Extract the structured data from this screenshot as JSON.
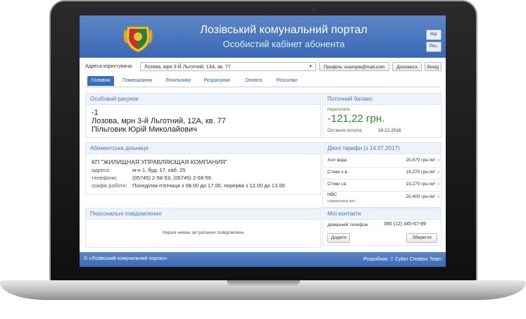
{
  "header": {
    "title": "Лозівський комунальний портал",
    "subtitle": "Особистий кабінет абонента",
    "lang_ukr": "Укр.",
    "lang_rus": "Рос."
  },
  "userbar": {
    "label": "Адреса користувача:",
    "address_value": "Лозова, мрн 3-Й Льготний, 13А, кв. 77",
    "profile_button": "Профіль: example@mail.com",
    "help_button": "Допомога",
    "exit_button": "Вихід"
  },
  "tabs": [
    "Головна",
    "Помешкання",
    "Лічильники",
    "Розрахунки",
    "Оплата",
    "Розсилки"
  ],
  "account": {
    "title": "Особовий рахунок",
    "number": "-1",
    "address": "Лозова, мрн 3-й Льготний, 12А, кв. 77",
    "owner": "Пільговик Юрій Миколайович"
  },
  "balance": {
    "title": "Поточний баланс",
    "status": "переплата",
    "amount": "-121,22 грн.",
    "last_payment_label": "Остання оплата:",
    "last_payment_date": "19.12.2016"
  },
  "subscriber": {
    "title": "Абонентська дільниця",
    "company": "КП \"ЖИЛИЩНАЯ УПРАВЛЯЮЩАЯ КОМПАНИЯ\"",
    "address_label": "адреса:",
    "address_value": "м-н 1, буд. 17, каб. 25",
    "phones_label": "телефони:",
    "phones_value": "(05745) 2-58-53; (05745) 2-58-56",
    "schedule_label": "графік роботи:",
    "schedule_value": "Понеділок-п'ятниця з 08.00 до 17.00, перерва з 12.00 до 13.00"
  },
  "tariffs": {
    "title": "Діючі тарифи (з 14.07.2017)",
    "rows": [
      {
        "name": "Хол вода",
        "value": "20,670 грн./м³"
      },
      {
        "name": "Стоки х.в.",
        "value": "19,270 грн./м³"
      },
      {
        "name": "Стоки г.в.",
        "value": "19,270 грн./м³"
      },
      {
        "name": "НВС",
        "note": "нормативне вод...",
        "value": "20,400 грн./м³"
      }
    ]
  },
  "messages": {
    "title": "Персональні повідомлення",
    "empty": "Наразі немає актуальних повідомлень"
  },
  "contacts": {
    "title": "Мої контакти",
    "phone_label": "домашній телефон",
    "phone_value": "380 (12) 345-67-89",
    "add_button": "Додати",
    "save_button": "Зберегти"
  },
  "footer": {
    "copyright": "© «Лозівський комунальний портал»",
    "dev_label": "Розробник:",
    "dev_name": "Cyber Creation Team"
  },
  "colors": {
    "header_blue": "#3a68b4",
    "accent_blue": "#3f74c4",
    "balance_green": "#2f8a2f"
  }
}
